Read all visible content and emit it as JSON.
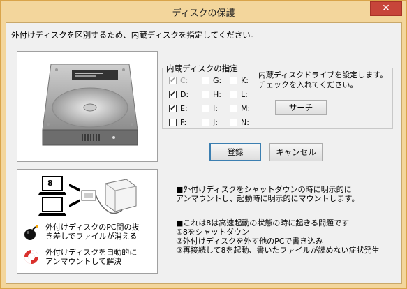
{
  "window": {
    "title": "ディスクの保護",
    "close_label": "✕"
  },
  "instruction": "外付けディスクを区別するため、内蔵ディスクを指定してください。",
  "drive_group": {
    "title": "内蔵ディスクの指定",
    "description_line1": "内蔵ディスクドライブを設定します。",
    "description_line2": "チェックを入れてください。",
    "drives": [
      {
        "label": "C:",
        "checked": true,
        "disabled": true
      },
      {
        "label": "D:",
        "checked": true,
        "disabled": false
      },
      {
        "label": "E:",
        "checked": true,
        "disabled": false
      },
      {
        "label": "F:",
        "checked": false,
        "disabled": false
      },
      {
        "label": "G:",
        "checked": false,
        "disabled": false
      },
      {
        "label": "H:",
        "checked": false,
        "disabled": false
      },
      {
        "label": "I:",
        "checked": false,
        "disabled": false
      },
      {
        "label": "J:",
        "checked": false,
        "disabled": false
      },
      {
        "label": "K:",
        "checked": false,
        "disabled": false
      },
      {
        "label": "L:",
        "checked": false,
        "disabled": false
      },
      {
        "label": "M:",
        "checked": false,
        "disabled": false
      },
      {
        "label": "N:",
        "checked": false,
        "disabled": false
      }
    ],
    "search_label": "サーチ"
  },
  "buttons": {
    "ok_label": "登録",
    "cancel_label": "キャンセル"
  },
  "info_panel": {
    "pc_label": "8",
    "note1_line1": "外付けディスクのPC間の抜",
    "note1_line2": "き差しでファイルが消える",
    "note2_line1": "外付けディスクを自動的に",
    "note2_line2": "アンマウントして解決"
  },
  "notes": {
    "block1_line1": "■外付けディスクをシャットダウンの時に明示的に",
    "block1_line2": "アンマウントし、起動時に明示的にマウントします。",
    "block2_line1": "■これは8は高速起動の状態の時に起きる問題です",
    "block2_line2": "①8をシャットダウン",
    "block2_line3": "②外付けディスクを外す他のPCで書き込み",
    "block2_line4": "③再接続して8を起動、書いたファイルが読めない症状発生"
  }
}
